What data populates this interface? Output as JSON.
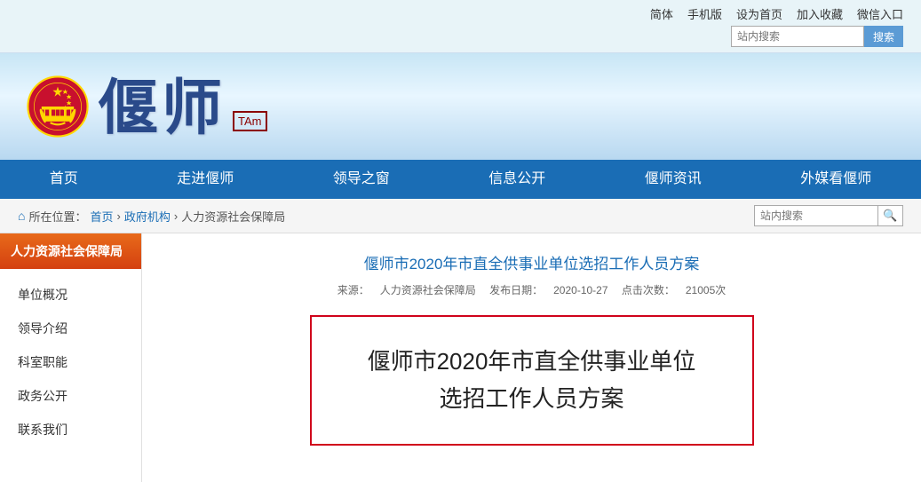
{
  "topbar": {
    "links": [
      "简体",
      "手机版",
      "设为首页",
      "加入收藏",
      "微信入口"
    ],
    "search_placeholder": "站内搜索",
    "search_button": "搜索"
  },
  "header": {
    "site_name": "偃师",
    "site_subtitle": "TAm",
    "emblem_alt": "国徽"
  },
  "nav": {
    "items": [
      "首页",
      "走进偃师",
      "领导之窗",
      "信息公开",
      "偃师资讯",
      "外媒看偃师"
    ]
  },
  "breadcrumb": {
    "home": "首页",
    "path": [
      "政府机构",
      "人力资源社会保障局"
    ],
    "search_placeholder": "站内搜索",
    "search_button": "🔍"
  },
  "sidebar": {
    "title": "人力资源社会保障局",
    "menu": [
      "单位概况",
      "领导介绍",
      "科室职能",
      "政务公开",
      "联系我们"
    ]
  },
  "article": {
    "title_link": "偃师市2020年市直全供事业单位选招工作人员方案",
    "source": "人力资源社会保障局",
    "publish_date": "2020-10-27",
    "views": "21005次",
    "highlight_line1": "偃师市2020年市直全供事业单位",
    "highlight_line2": "选招工作人员方案"
  }
}
